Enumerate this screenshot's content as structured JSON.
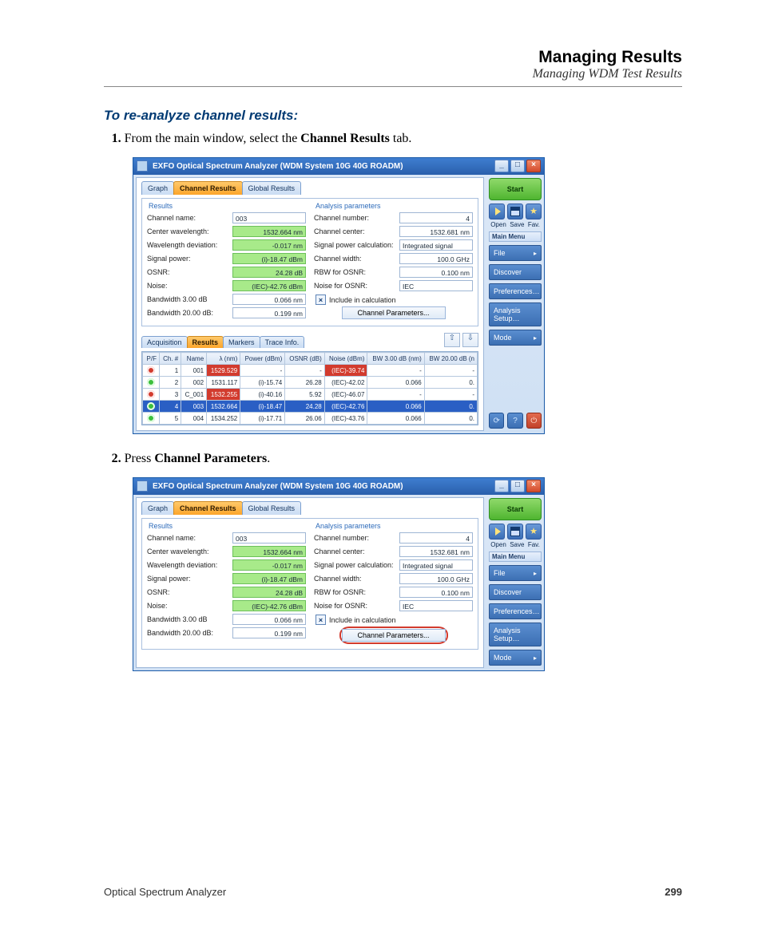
{
  "header": {
    "title": "Managing Results",
    "subtitle": "Managing WDM Test Results"
  },
  "lead": "To re-analyze channel results:",
  "step1": {
    "pre": "From the main window, select the ",
    "bold": "Channel Results",
    "post": " tab."
  },
  "step2": {
    "pre": "Press ",
    "bold": "Channel Parameters",
    "post": "."
  },
  "footer": {
    "left": "Optical Spectrum Analyzer",
    "page": "299"
  },
  "app": {
    "title": "EXFO Optical Spectrum Analyzer (WDM System 10G 40G ROADM)",
    "tabs": {
      "graph": "Graph",
      "channel": "Channel Results",
      "global": "Global Results"
    },
    "subtabs": {
      "acq": "Acquisition",
      "res": "Results",
      "mark": "Markers",
      "trace": "Trace Info."
    },
    "sidebar": {
      "start": "Start",
      "tool_labels": {
        "open": "Open",
        "save": "Save",
        "fav": "Fav."
      },
      "mainmenu": "Main Menu",
      "items": [
        "File",
        "Discover",
        "Preferences…",
        "Analysis Setup…",
        "Mode"
      ]
    },
    "results_title": "Results",
    "analysis_title": "Analysis parameters",
    "results": {
      "channel_name_k": "Channel name:",
      "channel_name_v": "003",
      "center_wl_k": "Center wavelength:",
      "center_wl_v": "1532.664 nm",
      "wl_dev_k": "Wavelength deviation:",
      "wl_dev_v": "-0.017 nm",
      "sig_power_k": "Signal power:",
      "sig_power_v": "(i)-18.47 dBm",
      "osnr_k": "OSNR:",
      "osnr_v": "24.28 dB",
      "noise_k": "Noise:",
      "noise_v": "(IEC)-42.76 dBm",
      "bw3_k": "Bandwidth 3.00 dB",
      "bw3_v": "0.066 nm",
      "bw20_k": "Bandwidth 20.00 dB:",
      "bw20_v": "0.199 nm"
    },
    "analysis": {
      "ch_num_k": "Channel number:",
      "ch_num_v": "4",
      "ch_center_k": "Channel center:",
      "ch_center_v": "1532.681 nm",
      "sig_calc_k": "Signal power calculation:",
      "sig_calc_v": "Integrated signal",
      "ch_width_k": "Channel width:",
      "ch_width_v": "100.0 GHz",
      "rbw_k": "RBW for OSNR:",
      "rbw_v": "0.100 nm",
      "noise_osnr_k": "Noise for OSNR:",
      "noise_osnr_v": "IEC",
      "include_k": "Include in calculation",
      "chan_params_btn": "Channel Parameters..."
    },
    "table": {
      "headers": [
        "P/F",
        "Ch. #",
        "Name",
        "λ (nm)",
        "Power (dBm)",
        "OSNR (dB)",
        "Noise (dBm)",
        "BW 3.00 dB (nm)",
        "BW 20.00 dB (n"
      ],
      "rows": [
        {
          "pf": "fail",
          "ch": "1",
          "name": "001",
          "lam": "1529.529",
          "lam_cls": "redc",
          "pow": "-",
          "osnr": "-",
          "noise": "(IEC)-39.74",
          "noise_cls": "redc",
          "bw3": "-",
          "bw20": "-"
        },
        {
          "pf": "pass",
          "ch": "2",
          "name": "002",
          "lam": "1531.117",
          "pow": "(i)-15.74",
          "osnr": "26.28",
          "noise": "(IEC)-42.02",
          "bw3": "0.066",
          "bw20": "0."
        },
        {
          "pf": "fail",
          "ch": "3",
          "name": "C_001",
          "lam": "1532.255",
          "lam_cls": "redc",
          "pow": "(i)-40.16",
          "osnr": "5.92",
          "noise": "(IEC)-46.07",
          "bw3": "-",
          "bw20": "-"
        },
        {
          "pf": "pass",
          "sel": true,
          "ch": "4",
          "name": "003",
          "lam": "1532.664",
          "pow": "(i)-18.47",
          "osnr": "24.28",
          "noise": "(IEC)-42.76",
          "bw3": "0.066",
          "bw20": "0."
        },
        {
          "pf": "pass",
          "ch": "5",
          "name": "004",
          "lam": "1534.252",
          "pow": "(i)-17.71",
          "osnr": "26.06",
          "noise": "(IEC)-43.76",
          "bw3": "0.066",
          "bw20": "0."
        }
      ]
    }
  }
}
